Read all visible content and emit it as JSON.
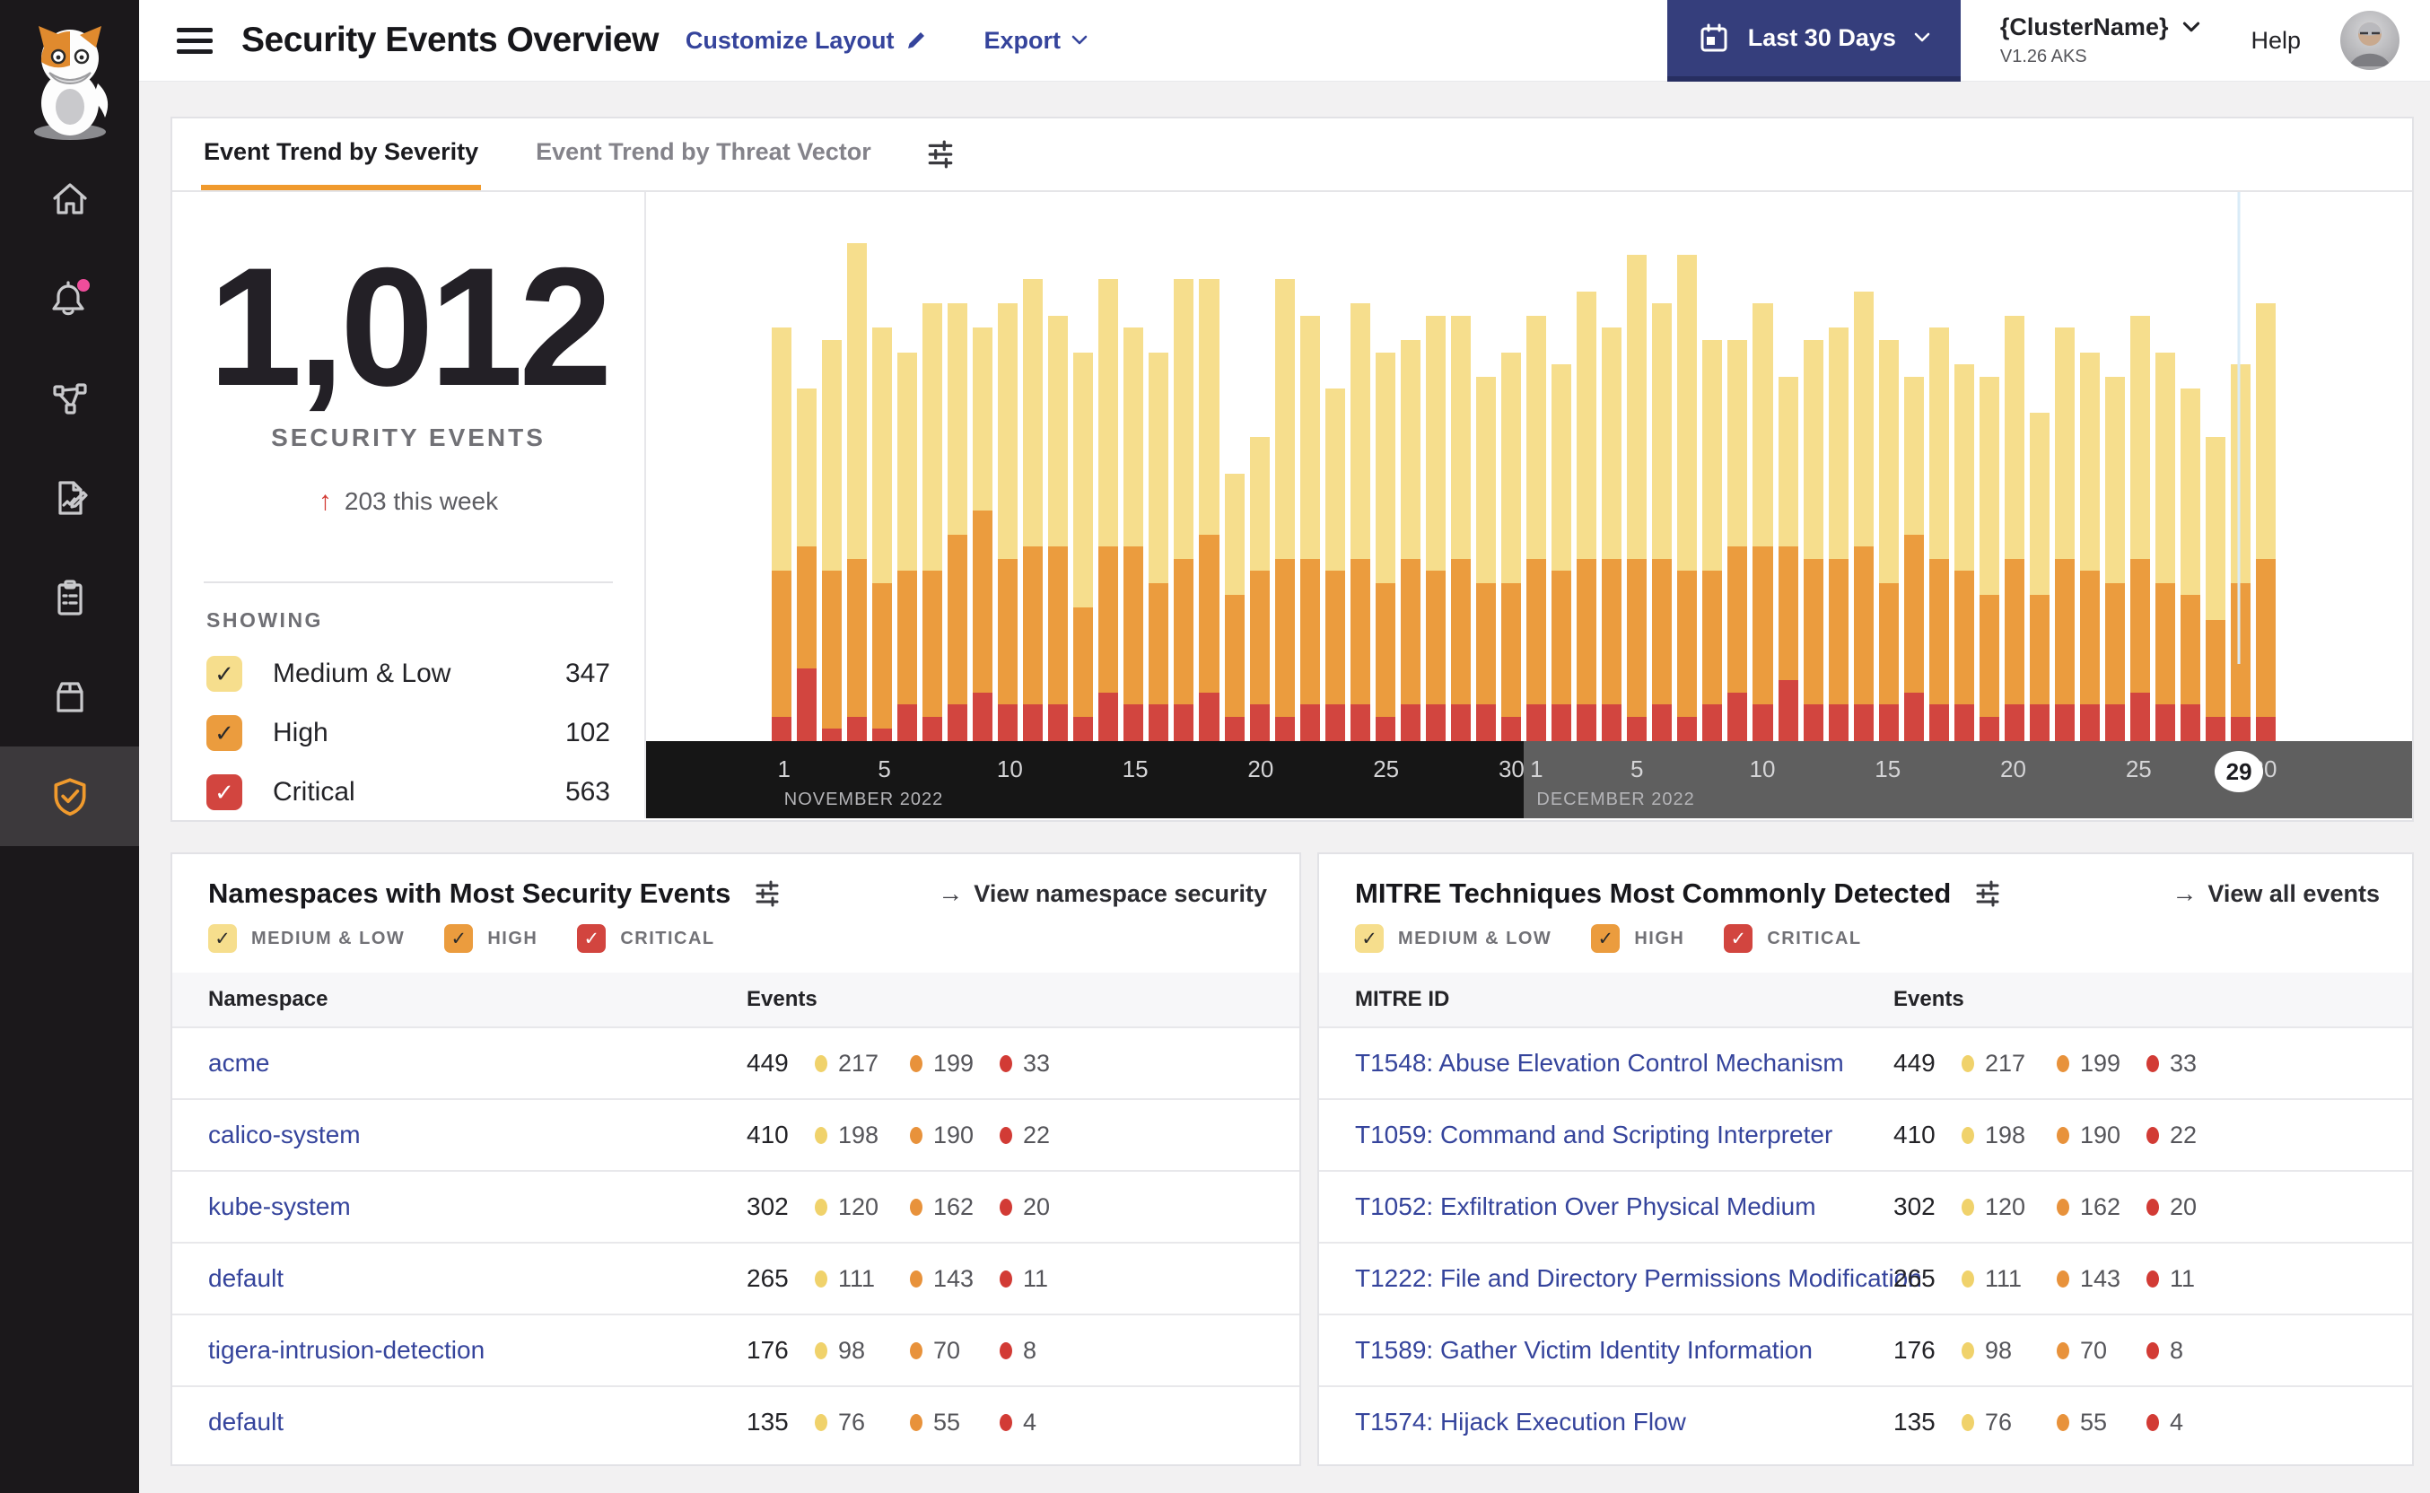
{
  "colors": {
    "accent_orange": "#F09A2D",
    "link_blue": "#35449C",
    "button_navy": "#353E7C",
    "pink_badge": "#EF4D9B",
    "severity": {
      "medium_low": "#F6DE8D",
      "high": "#EB9C3E",
      "critical": "#D2453F"
    },
    "severity_dots": {
      "medium_low": "#F0D26B",
      "high": "#E8923B",
      "critical": "#D23B35"
    },
    "checkbox_check": {
      "medium_low": "#2b2b2b",
      "high": "#2b2b2b",
      "critical": "#ffffff"
    }
  },
  "sidebar": {
    "items": [
      {
        "icon": "home-icon",
        "active": false,
        "badge": false
      },
      {
        "icon": "alerts-bell-icon",
        "active": false,
        "badge": true
      },
      {
        "icon": "service-graph-icon",
        "active": false,
        "badge": false
      },
      {
        "icon": "report-edit-icon",
        "active": false,
        "badge": false
      },
      {
        "icon": "compliance-clipboard-icon",
        "active": false,
        "badge": false
      },
      {
        "icon": "workloads-box-icon",
        "active": false,
        "badge": false
      },
      {
        "icon": "security-shield-icon",
        "active": true,
        "badge": false
      }
    ]
  },
  "header": {
    "title": "Security Events Overview",
    "customize_label": "Customize Layout",
    "export_label": "Export",
    "date_range_label": "Last 30 Days",
    "cluster_name": "{ClusterName}",
    "cluster_version": "V1.26 AKS",
    "help_label": "Help"
  },
  "tabs": [
    {
      "label": "Event Trend by Severity",
      "active": true
    },
    {
      "label": "Event Trend by Threat Vector",
      "active": false
    }
  ],
  "summary": {
    "total": "1,012",
    "caption": "SECURITY EVENTS",
    "delta": "203 this week",
    "delta_direction": "up",
    "showing_label": "SHOWING",
    "severities": [
      {
        "label": "Medium & Low",
        "value": "347",
        "key": "medium_low",
        "checked": true
      },
      {
        "label": "High",
        "value": "102",
        "key": "high",
        "checked": true
      },
      {
        "label": "Critical",
        "value": "563",
        "key": "critical",
        "checked": true
      }
    ]
  },
  "chart_data": {
    "type": "bar",
    "stacked": true,
    "stack_order_bottom_to_top": [
      "Critical",
      "High",
      "Medium & Low"
    ],
    "grid": false,
    "ylim": [
      0,
      44
    ],
    "months": [
      {
        "label": "NOVEMBER 2022",
        "ticks": [
          1,
          5,
          10,
          15,
          20,
          25,
          30
        ],
        "days": 30
      },
      {
        "label": "DECEMBER 2022",
        "ticks": [
          1,
          5,
          10,
          15,
          20,
          25,
          30
        ],
        "days": 30
      }
    ],
    "highlight": {
      "month_index": 1,
      "day": 29
    },
    "series": [
      {
        "name": "Medium & Low",
        "color": "#F6DE8D",
        "values": [
          20,
          13,
          19,
          26,
          21,
          18,
          22,
          19,
          15,
          21,
          22,
          19,
          21,
          22,
          18,
          19,
          23,
          21,
          10,
          11,
          23,
          20,
          15,
          21,
          19,
          18,
          21,
          20,
          17,
          19,
          20,
          17,
          22,
          19,
          25,
          21,
          26,
          19,
          17,
          20,
          14,
          18,
          19,
          21,
          20,
          13,
          19,
          17,
          18,
          20,
          15,
          19,
          18,
          17,
          20,
          19,
          17,
          15,
          18,
          21
        ]
      },
      {
        "name": "High",
        "color": "#EB9C3E",
        "values": [
          12,
          10,
          13,
          13,
          12,
          11,
          12,
          14,
          15,
          12,
          13,
          13,
          9,
          12,
          13,
          10,
          12,
          13,
          10,
          11,
          13,
          12,
          11,
          12,
          11,
          12,
          11,
          12,
          10,
          11,
          12,
          11,
          12,
          12,
          13,
          12,
          12,
          11,
          12,
          13,
          11,
          12,
          12,
          13,
          10,
          13,
          12,
          11,
          10,
          12,
          9,
          12,
          11,
          10,
          11,
          10,
          9,
          8,
          11,
          13
        ]
      },
      {
        "name": "Critical",
        "color": "#D2453F",
        "values": [
          2,
          6,
          1,
          2,
          1,
          3,
          2,
          3,
          4,
          3,
          3,
          3,
          2,
          4,
          3,
          3,
          3,
          4,
          2,
          3,
          2,
          3,
          3,
          3,
          2,
          3,
          3,
          3,
          3,
          2,
          3,
          3,
          3,
          3,
          2,
          3,
          2,
          3,
          4,
          3,
          5,
          3,
          3,
          3,
          3,
          4,
          3,
          3,
          2,
          3,
          3,
          3,
          3,
          3,
          4,
          3,
          3,
          2,
          2,
          2
        ]
      }
    ]
  },
  "namespaces_panel": {
    "title": "Namespaces with Most Security Events",
    "link": "View namespace security",
    "filters": [
      {
        "label": "MEDIUM & LOW",
        "key": "medium_low",
        "checked": true
      },
      {
        "label": "HIGH",
        "key": "high",
        "checked": true
      },
      {
        "label": "CRITICAL",
        "key": "critical",
        "checked": true
      }
    ],
    "columns": [
      "Namespace",
      "Events"
    ],
    "rows": [
      {
        "name": "acme",
        "total": "449",
        "medium_low": "217",
        "high": "199",
        "critical": "33"
      },
      {
        "name": "calico-system",
        "total": "410",
        "medium_low": "198",
        "high": "190",
        "critical": "22"
      },
      {
        "name": "kube-system",
        "total": "302",
        "medium_low": "120",
        "high": "162",
        "critical": "20"
      },
      {
        "name": "default",
        "total": "265",
        "medium_low": "111",
        "high": "143",
        "critical": "11"
      },
      {
        "name": "tigera-intrusion-detection",
        "total": "176",
        "medium_low": "98",
        "high": "70",
        "critical": "8"
      },
      {
        "name": "default",
        "total": "135",
        "medium_low": "76",
        "high": "55",
        "critical": "4"
      }
    ]
  },
  "mitre_panel": {
    "title": "MITRE Techniques Most Commonly Detected",
    "link": "View all events",
    "filters": [
      {
        "label": "MEDIUM & LOW",
        "key": "medium_low",
        "checked": true
      },
      {
        "label": "HIGH",
        "key": "high",
        "checked": true
      },
      {
        "label": "CRITICAL",
        "key": "critical",
        "checked": true
      }
    ],
    "columns": [
      "MITRE ID",
      "Events"
    ],
    "rows": [
      {
        "name": "T1548: Abuse Elevation Control Mechanism",
        "total": "449",
        "medium_low": "217",
        "high": "199",
        "critical": "33"
      },
      {
        "name": "T1059: Command and Scripting Interpreter",
        "total": "410",
        "medium_low": "198",
        "high": "190",
        "critical": "22"
      },
      {
        "name": "T1052: Exfiltration Over Physical Medium",
        "total": "302",
        "medium_low": "120",
        "high": "162",
        "critical": "20"
      },
      {
        "name": "T1222: File and Directory Permissions Modification",
        "total": "265",
        "medium_low": "111",
        "high": "143",
        "critical": "11"
      },
      {
        "name": "T1589: Gather Victim Identity Information",
        "total": "176",
        "medium_low": "98",
        "high": "70",
        "critical": "8"
      },
      {
        "name": "T1574: Hijack Execution Flow",
        "total": "135",
        "medium_low": "76",
        "high": "55",
        "critical": "4"
      }
    ]
  }
}
